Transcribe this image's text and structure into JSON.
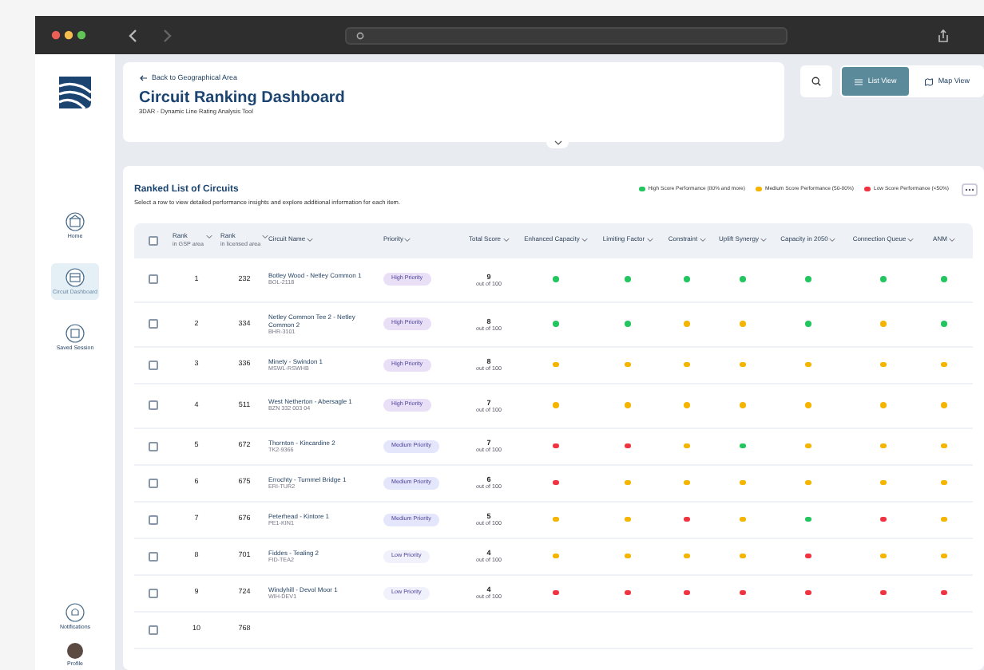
{
  "header": {
    "back_link": "Back to Geographical Area",
    "title": "Circuit Ranking Dashboard",
    "subtitle": "3DAR - Dynamic Line Rating Analysis Tool"
  },
  "view_buttons": [
    {
      "label": "List View",
      "selected": true
    },
    {
      "label": "Map View",
      "selected": false
    }
  ],
  "sidebar": {
    "items": [
      {
        "label": "Home",
        "selected": false
      },
      {
        "label": "Circuit Dashboard",
        "selected": true
      },
      {
        "label": "Saved Session",
        "selected": false
      }
    ],
    "bottom_items": [
      {
        "label": "Notifications"
      },
      {
        "label": "Profile"
      }
    ]
  },
  "table": {
    "title": "Ranked List of Circuits",
    "subtitle": "Select a row to view detailed performance insights and explore additional information for each item.",
    "all_checked": false,
    "legend": [
      {
        "label": "High Score Performance (80% and more)",
        "color": "#22c55e"
      },
      {
        "label": "Medium Score Performance (50-80%)",
        "color": "#f5b400"
      },
      {
        "label": "Low Score Performance (<50%)",
        "color": "#ef3340"
      }
    ],
    "columns": [
      {
        "label": "Rank",
        "sublabel": "in GSP area"
      },
      {
        "label": "Rank",
        "sublabel": "in licensed area"
      },
      {
        "label": "Circuit Name"
      },
      {
        "label": "Priority"
      },
      {
        "label": "Total Score"
      },
      {
        "label": "Enhanced Capacity"
      },
      {
        "label": "Limiting Factor"
      },
      {
        "label": "Constraint"
      },
      {
        "label": "Uplift Synergy"
      },
      {
        "label": "Capacity in 2050"
      },
      {
        "label": "Connection Queue"
      },
      {
        "label": "ANM"
      }
    ],
    "rows": [
      {
        "checked": false,
        "rank": "1",
        "licensed_rank": "232",
        "name": "Botley Wood - Netley Common 1",
        "code": "BOL-2118",
        "priority": {
          "text": "High Priority",
          "color": "#e9e0f7"
        },
        "score": "9",
        "score_note": "out of 100",
        "dots": [
          {
            "color": "#22c55e"
          },
          {
            "color": "#22c55e"
          },
          {
            "color": "#22c55e"
          },
          {
            "color": "#22c55e"
          },
          {
            "color": "#22c55e"
          },
          {
            "color": "#22c55e"
          },
          {
            "color": "#22c55e"
          }
        ]
      },
      {
        "checked": false,
        "rank": "2",
        "licensed_rank": "334",
        "name": "Netley Common Tee 2 - Netley Common 2",
        "code": "BHR-3101",
        "priority": {
          "text": "High Priority",
          "color": "#e9e0f7"
        },
        "score": "8",
        "score_note": "out of 100",
        "dots": [
          {
            "color": "#22c55e"
          },
          {
            "color": "#22c55e"
          },
          {
            "color": "#f5b400"
          },
          {
            "color": "#f5b400"
          },
          {
            "color": "#22c55e"
          },
          {
            "color": "#f5b400"
          },
          {
            "color": "#22c55e"
          }
        ]
      },
      {
        "checked": false,
        "rank": "3",
        "licensed_rank": "336",
        "name": "Minety - Swindon 1",
        "code": "MSWL-RSWHB",
        "priority": {
          "text": "High Priority",
          "color": "#e9e0f7"
        },
        "score": "8",
        "score_note": "out of 100",
        "dots": [
          {
            "color": "#f5b400"
          },
          {
            "color": "#f5b400"
          },
          {
            "color": "#f5b400"
          },
          {
            "color": "#f5b400"
          },
          {
            "color": "#f5b400"
          },
          {
            "color": "#f5b400"
          },
          {
            "color": "#f5b400"
          }
        ]
      },
      {
        "checked": false,
        "rank": "4",
        "licensed_rank": "511",
        "name": "West Netherton - Abersagle 1",
        "code": "BZN 332 003 04",
        "priority": {
          "text": "High Priority",
          "color": "#e9e0f7"
        },
        "score": "7",
        "score_note": "out of 100",
        "dots": [
          {
            "color": "#f5b400"
          },
          {
            "color": "#f5b400"
          },
          {
            "color": "#f5b400"
          },
          {
            "color": "#f5b400"
          },
          {
            "color": "#f5b400"
          },
          {
            "color": "#f5b400"
          },
          {
            "color": "#f5b400"
          }
        ]
      },
      {
        "checked": false,
        "rank": "5",
        "licensed_rank": "672",
        "name": "Thornton - Kincardine 2",
        "code": "TK2-9366",
        "priority": {
          "text": "Medium Priority",
          "color": "#e4e6fb"
        },
        "score": "7",
        "score_note": "out of 100",
        "dots": [
          {
            "color": "#ef3340"
          },
          {
            "color": "#ef3340"
          },
          {
            "color": "#f5b400"
          },
          {
            "color": "#22c55e"
          },
          {
            "color": "#f5b400"
          },
          {
            "color": "#f5b400"
          },
          {
            "color": "#f5b400"
          }
        ]
      },
      {
        "checked": false,
        "rank": "6",
        "licensed_rank": "675",
        "name": "Errochty - Tummel Bridge 1",
        "code": "ERI-TUR2",
        "priority": {
          "text": "Medium Priority",
          "color": "#e4e6fb"
        },
        "score": "6",
        "score_note": "out of 100",
        "dots": [
          {
            "color": "#ef3340"
          },
          {
            "color": "#f5b400"
          },
          {
            "color": "#f5b400"
          },
          {
            "color": "#f5b400"
          },
          {
            "color": "#f5b400"
          },
          {
            "color": "#f5b400"
          },
          {
            "color": "#f5b400"
          }
        ]
      },
      {
        "checked": false,
        "rank": "7",
        "licensed_rank": "676",
        "name": "Peterhead - Kintore 1",
        "code": "PE1-KIN1",
        "priority": {
          "text": "Medium Priority",
          "color": "#e4e6fb"
        },
        "score": "5",
        "score_note": "out of 100",
        "dots": [
          {
            "color": "#f5b400"
          },
          {
            "color": "#f5b400"
          },
          {
            "color": "#ef3340"
          },
          {
            "color": "#f5b400"
          },
          {
            "color": "#22c55e"
          },
          {
            "color": "#ef3340"
          },
          {
            "color": "#f5b400"
          }
        ]
      },
      {
        "checked": false,
        "rank": "8",
        "licensed_rank": "701",
        "name": "Fiddes - Tealing 2",
        "code": "FID-TEA2",
        "priority": {
          "text": "Low Priority",
          "color": "#f0f1fb"
        },
        "score": "4",
        "score_note": "out of 100",
        "dots": [
          {
            "color": "#f5b400"
          },
          {
            "color": "#f5b400"
          },
          {
            "color": "#f5b400"
          },
          {
            "color": "#f5b400"
          },
          {
            "color": "#ef3340"
          },
          {
            "color": "#f5b400"
          },
          {
            "color": "#f5b400"
          }
        ]
      },
      {
        "checked": false,
        "rank": "9",
        "licensed_rank": "724",
        "name": "Windyhill - Devol Moor 1",
        "code": "WIH-DEV1",
        "priority": {
          "text": "Low Priority",
          "color": "#f0f1fb"
        },
        "score": "4",
        "score_note": "out of 100",
        "dots": [
          {
            "color": "#ef3340"
          },
          {
            "color": "#ef3340"
          },
          {
            "color": "#ef3340"
          },
          {
            "color": "#ef3340"
          },
          {
            "color": "#ef3340"
          },
          {
            "color": "#ef3340"
          },
          {
            "color": "#ef3340"
          }
        ]
      },
      {
        "checked": false,
        "rank": "10",
        "licensed_rank": "768"
      }
    ]
  }
}
